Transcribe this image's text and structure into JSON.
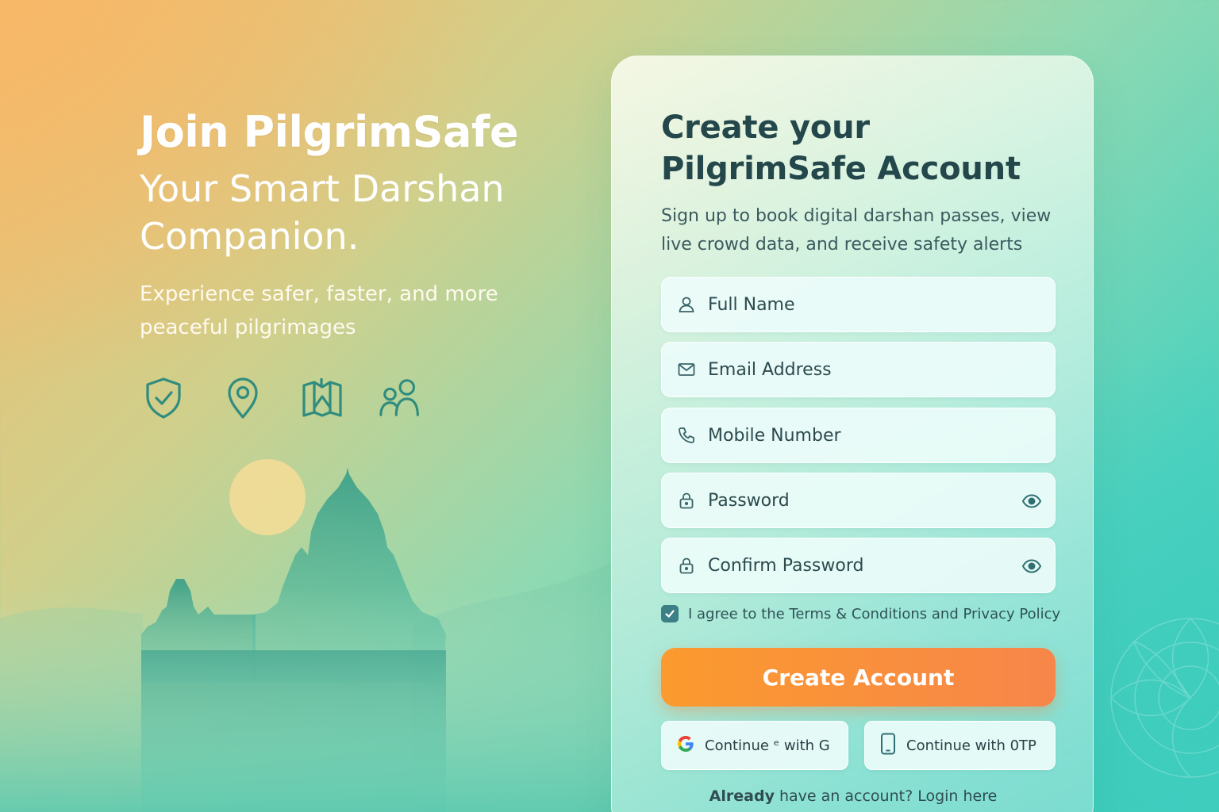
{
  "hero": {
    "title": "Join PilgrimSafe",
    "tagline": "Your Smart Darshan Companion.",
    "description": "Experience safer, faster, and more peaceful pilgrimages",
    "feature_icons": [
      "shield-check-icon",
      "location-pin-icon",
      "map-icon",
      "group-icon"
    ]
  },
  "card": {
    "title": "Create your PilgrimSafe Account",
    "subtitle": "Sign up to book digital darshan passes, view live crowd data, and receive safety alerts",
    "fields": {
      "full_name": {
        "placeholder": "Full Name",
        "icon": "user-icon"
      },
      "email": {
        "placeholder": "Email Address",
        "icon": "mail-icon"
      },
      "mobile": {
        "placeholder": "Mobile Number",
        "icon": "phone-icon"
      },
      "password": {
        "placeholder": "Password",
        "icon": "lock-icon"
      },
      "confirm_password": {
        "placeholder": "Confirm Password",
        "icon": "lock-icon"
      }
    },
    "agree": {
      "checked": true,
      "text": "I agree to the Terms & Conditions and Privacy Policy"
    },
    "create_button": "Create Account",
    "google_button": "Continue ᵉ with G",
    "otp_button": "Continue with 0TP",
    "login_prompt_bold": "Already",
    "login_prompt_rest": " have an account? Login here"
  },
  "colors": {
    "accent_orange": "#fb9a2e",
    "teal_dark": "#2f8c7e",
    "text_dark": "#24474b"
  }
}
